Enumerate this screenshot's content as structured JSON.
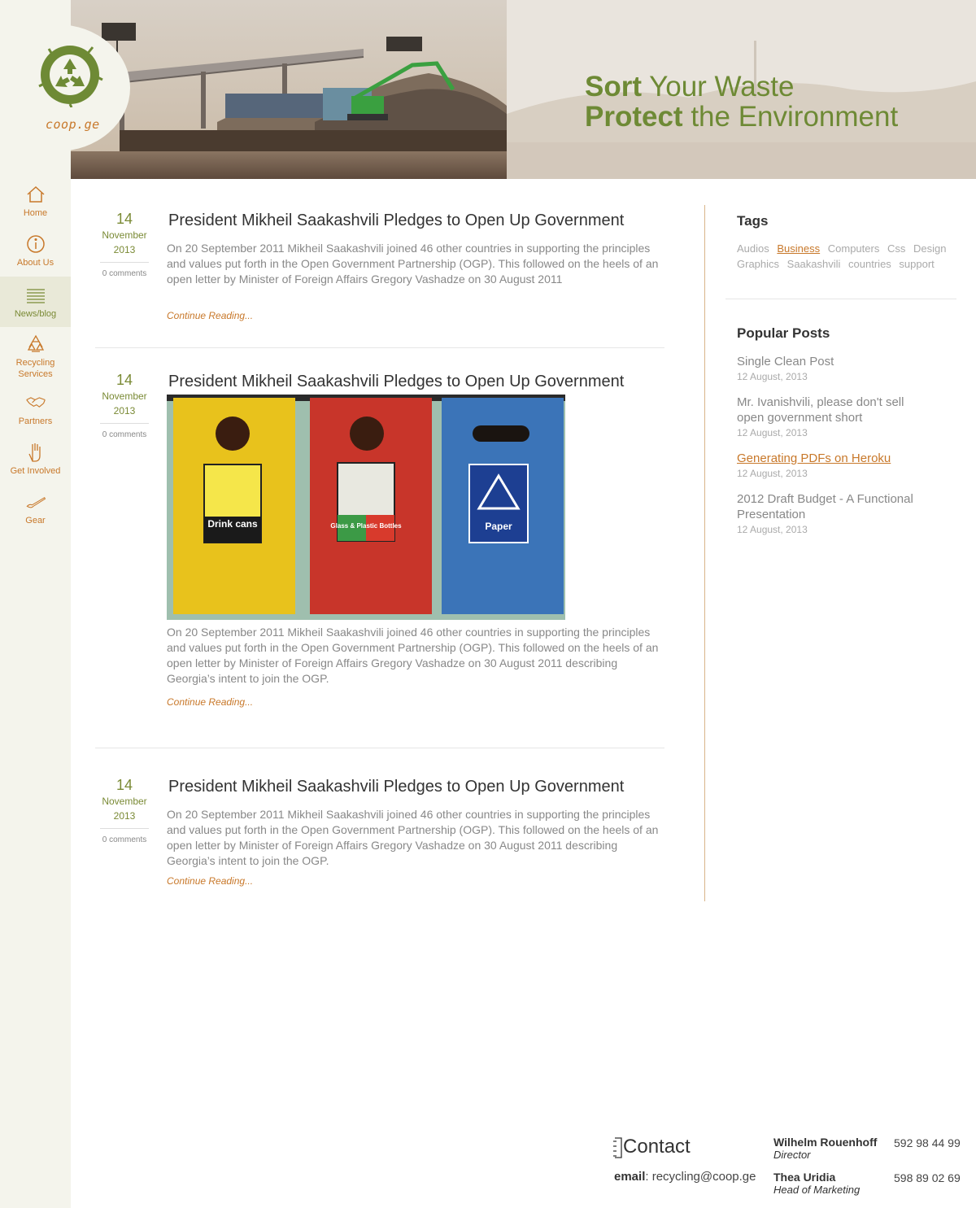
{
  "brand": {
    "logo_text": "coop.ge",
    "color_primary": "#6e8a35",
    "color_accent": "#c8782a"
  },
  "hero": {
    "line1_bold": "Sort",
    "line1_rest": " Your Waste",
    "line2_bold": "Protect",
    "line2_rest": " the Environment"
  },
  "nav": [
    {
      "label": "Home",
      "icon": "home-icon"
    },
    {
      "label": "About Us",
      "icon": "info-icon"
    },
    {
      "label": "News/blog",
      "icon": "news-icon",
      "active": true
    },
    {
      "label": "Recycling Services",
      "icon": "recycle-icon"
    },
    {
      "label": "Partners",
      "icon": "handshake-icon"
    },
    {
      "label": "Get Involved",
      "icon": "hand-icon"
    },
    {
      "label": "Gear",
      "icon": "brush-icon"
    }
  ],
  "posts": [
    {
      "day": "14",
      "month": "November",
      "year": "2013",
      "comments": "0 comments",
      "title": "President Mikheil Saakashvili Pledges to Open Up Government",
      "excerpt": "On 20 September 2011 Mikheil Saakashvili joined 46 other countries in supporting the principles and values put forth in the Open Government Partnership (OGP). This followed on the heels of an open letter by Minister of Foreign Affairs Gregory Vashadze on 30 August 2011",
      "continue": "Continue Reading..."
    },
    {
      "day": "14",
      "month": "November",
      "year": "2013",
      "comments": "0 comments",
      "title": "President Mikheil Saakashvili Pledges to Open Up Government",
      "image": {
        "bin1": "Drink cans",
        "bin2": "Glass & Plastic Bottles",
        "bin3": "Paper"
      },
      "excerpt": "On 20 September 2011 Mikheil Saakashvili joined 46 other countries in supporting the principles and values put forth in the Open Government Partnership (OGP). This followed on the heels of an open letter by Minister of Foreign Affairs Gregory Vashadze on 30 August 2011 describing Georgia’s intent to join the OGP.",
      "continue": "Continue Reading..."
    },
    {
      "day": "14",
      "month": "November",
      "year": "2013",
      "comments": "0 comments",
      "title": "President Mikheil Saakashvili Pledges to Open Up Government",
      "excerpt": "On 20 September 2011 Mikheil Saakashvili joined 46 other countries in supporting the principles and values put forth in the Open Government Partnership (OGP). This followed on the heels of an open letter by Minister of Foreign Affairs Gregory Vashadze on 30 August 2011 describing Georgia’s intent to join the OGP.",
      "continue": "Continue Reading..."
    }
  ],
  "tags": {
    "title": "Tags",
    "items": [
      "Audios",
      "Business",
      "Computers",
      "Css",
      "Design",
      "Graphics",
      "Saakashvili",
      "countries",
      "support"
    ],
    "highlighted": "Business"
  },
  "popular": {
    "title": "Popular Posts",
    "items": [
      {
        "title": "Single Clean Post",
        "date": "12 August, 2013"
      },
      {
        "title": "Mr. Ivanishvili, please don't sell open government short",
        "date": "12 August, 2013"
      },
      {
        "title": "Generating PDFs on Heroku",
        "date": "12 August, 2013",
        "highlighted": true
      },
      {
        "title": "2012 Draft Budget - A Functional Presentation",
        "date": "12 August, 2013"
      }
    ]
  },
  "contact": {
    "title_initial": "C",
    "title_rest": "ontact",
    "email_label": "email",
    "email": "recycling@coop.ge",
    "people": [
      {
        "name": "Wilhelm Rouenhoff",
        "role": "Director",
        "phone": "592 98 44 99"
      },
      {
        "name": "Thea Uridia",
        "role": "Head of Marketing",
        "phone": "598 89 02 69"
      }
    ]
  }
}
